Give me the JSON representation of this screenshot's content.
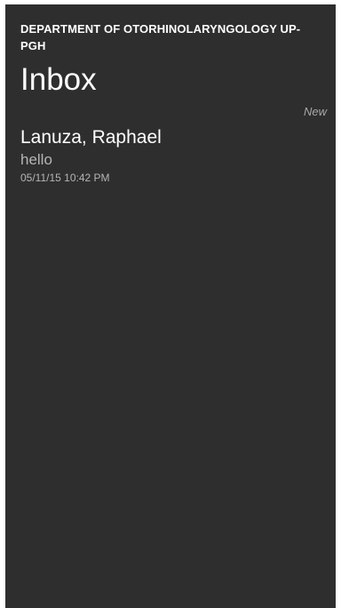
{
  "header": {
    "org_title": "DEPARTMENT OF OTORHINOLARYNGOLOGY UP-PGH",
    "page_title": "Inbox"
  },
  "messages": [
    {
      "badge": "New",
      "sender": "Lanuza, Raphael",
      "preview": "hello",
      "timestamp": "05/11/15 10:42 PM"
    }
  ]
}
